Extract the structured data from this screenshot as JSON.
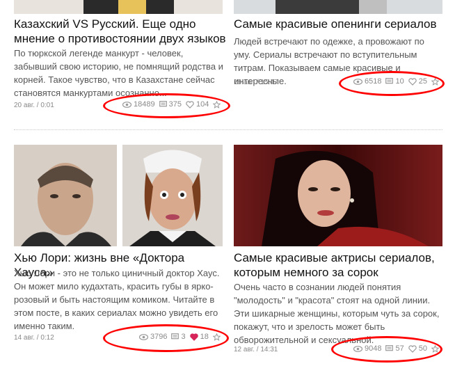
{
  "cards": [
    {
      "title": "Казахский VS Русский. Еще одно мнение о противостоянии двух языков",
      "description": "По тюркской легенде манкурт - человек, забывший свою историю, не помнящий родства и корней. Такое чувство, что в Казахстане сейчас становятся манкуртами осознанно...",
      "date": "20 авг. / 0:01",
      "views": "18489",
      "comments": "375",
      "likes": "104"
    },
    {
      "title": "Самые красивые опенинги сериалов",
      "description": "Людей встречают по одежке, а провожают по уму. Сериалы встречают по вступительным титрам. Показываем самые красивые и интересные.",
      "date": "18 авг. / 15:47",
      "views": "6518",
      "comments": "10",
      "likes": "25"
    },
    {
      "title": "Хью Лори: жизнь вне «Доктора Хауса»",
      "description": "Хью Лори - это не только циничный доктор Хаус. Он может мило кудахтать, красить губы в ярко-розовый и быть настоящим комиком. Читайте в этом посте, в каких сериалах можно увидеть его именно таким.",
      "date": "14 авг. / 0:12",
      "views": "3796",
      "comments": "3",
      "likes": "18"
    },
    {
      "title": "Самые красивые актрисы сериалов, которым немного за сорок",
      "description": "Очень часто в сознании людей понятия \"молодость\" и \"красота\" стоят на одной линии. Эти шикарные женщины, которым чуть за сорок, покажут, что и зрелость может быть обворожительной и сексуальной.",
      "date": "12 авг. / 14:31",
      "views": "9048",
      "comments": "57",
      "likes": "50"
    }
  ],
  "colors": {
    "highlight": "#ff0000",
    "liked_heart": "#d6245a",
    "meta": "#8a8a8a"
  }
}
